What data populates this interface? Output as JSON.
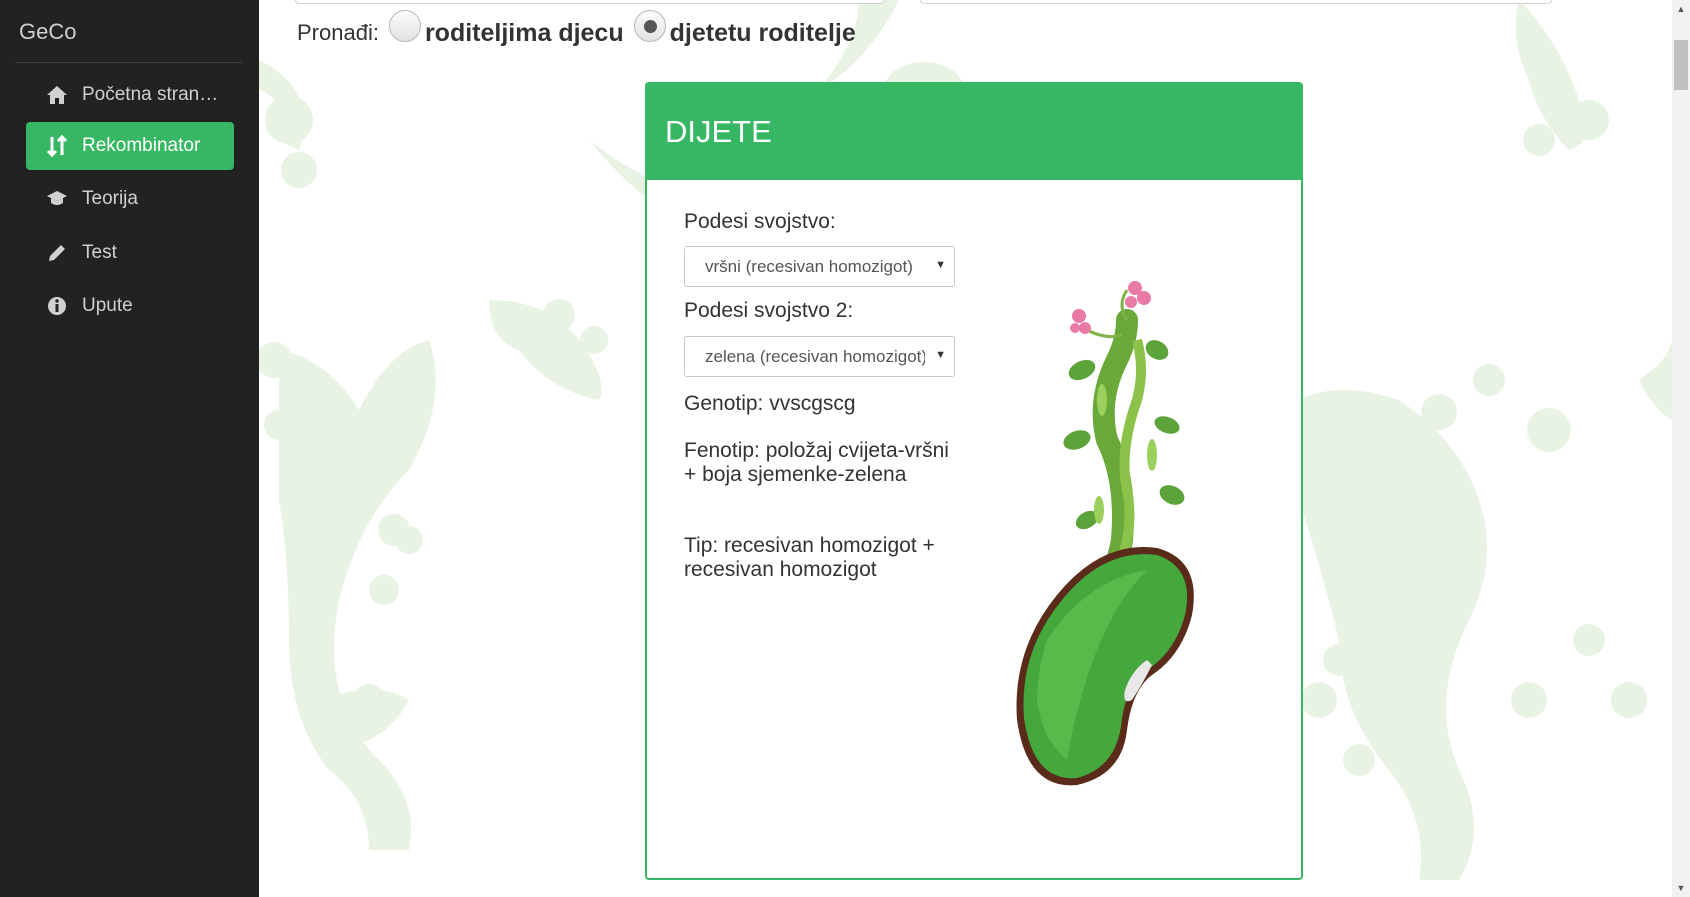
{
  "sidebar": {
    "brand": "GeCo",
    "items": [
      {
        "label": "Početna stran…",
        "icon": "home-icon",
        "active": false
      },
      {
        "label": "Rekombinator",
        "icon": "sort-arrows-icon",
        "active": true
      },
      {
        "label": "Teorija",
        "icon": "graduation-cap-icon",
        "active": false
      },
      {
        "label": "Test",
        "icon": "pencil-icon",
        "active": false
      },
      {
        "label": "Upute",
        "icon": "info-circle-icon",
        "active": false
      }
    ]
  },
  "find": {
    "label": "Pronađi:",
    "option1": "roditeljima djecu",
    "option2": "djetetu roditelje",
    "selected": "option2"
  },
  "card": {
    "title": "DIJETE",
    "trait1_label": "Podesi svojstvo:",
    "trait1_value": "vršni (recesivan homozigot)",
    "trait2_label": "Podesi svojstvo 2:",
    "trait2_value": "zelena (recesivan homozigot)",
    "genotype": "Genotip: vvscgscg",
    "phenotype": "Fenotip: položaj cvijeta-vršni + boja sjemenke-zelena",
    "type": "Tip: recesivan homozigot + recesivan homozigot"
  },
  "colors": {
    "accent": "#37b763",
    "sidebar_bg": "#222222",
    "decor": "#e6f2e2"
  }
}
